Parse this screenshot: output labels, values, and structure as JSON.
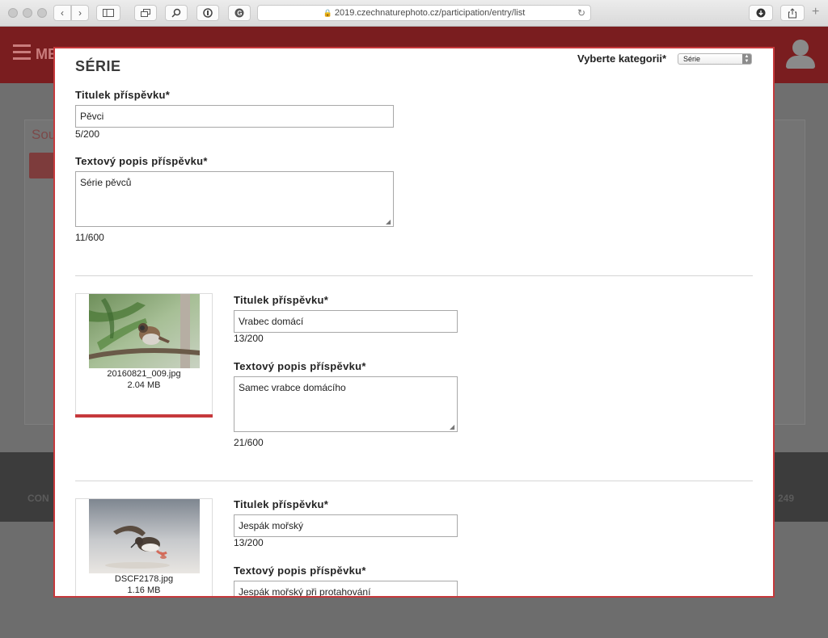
{
  "browser": {
    "url": "2019.czechnaturephoto.cz/participation/entry/list"
  },
  "background": {
    "menu_label": "ME",
    "card_title": "Sou",
    "footer_left": "CON",
    "footer_right": "249"
  },
  "modal": {
    "title": "SÉRIE",
    "category": {
      "label": "Vyberte kategorii*",
      "selected": "Série"
    },
    "series": {
      "title_label": "Titulek příspěvku*",
      "title_value": "Pěvci",
      "title_counter": "5/200",
      "desc_label": "Textový popis příspěvku*",
      "desc_value": "Série pěvců",
      "desc_counter": "11/600"
    },
    "entries": [
      {
        "filename": "20160821_009.jpg",
        "filesize": "2.04 MB",
        "title_label": "Titulek příspěvku*",
        "title_value": "Vrabec domácí",
        "title_counter": "13/200",
        "desc_label": "Textový popis příspěvku*",
        "desc_value": "Samec vrabce domácího",
        "desc_counter": "21/600"
      },
      {
        "filename": "DSCF2178.jpg",
        "filesize": "1.16 MB",
        "title_label": "Titulek příspěvku*",
        "title_value": "Jespák mořský",
        "title_counter": "13/200",
        "desc_label": "Textový popis příspěvku*",
        "desc_value": "Jespák mořský při protahování"
      }
    ]
  }
}
